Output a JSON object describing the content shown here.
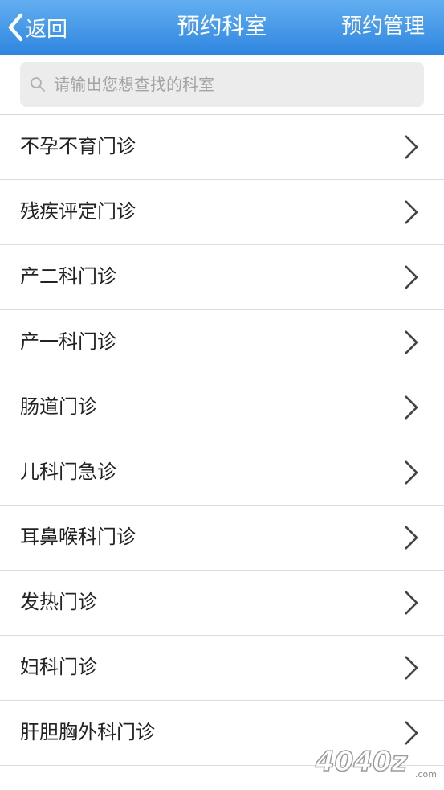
{
  "nav": {
    "back_label": "返回",
    "title": "预约科室",
    "right_label": "预约管理",
    "back_icon": "chevron-left-icon",
    "background_color": "#3b8fe4"
  },
  "search": {
    "placeholder": "请输出您想查找的科室",
    "value": "",
    "icon": "search-icon"
  },
  "departments": [
    {
      "label": "不孕不育门诊"
    },
    {
      "label": "残疾评定门诊"
    },
    {
      "label": "产二科门诊"
    },
    {
      "label": "产一科门诊"
    },
    {
      "label": "肠道门诊"
    },
    {
      "label": "儿科门急诊"
    },
    {
      "label": "耳鼻喉科门诊"
    },
    {
      "label": "发热门诊"
    },
    {
      "label": "妇科门诊"
    },
    {
      "label": "肝胆胸外科门诊"
    }
  ],
  "row_icon": "chevron-right-icon",
  "watermark": {
    "text": "4040z",
    "suffix": ".com"
  }
}
